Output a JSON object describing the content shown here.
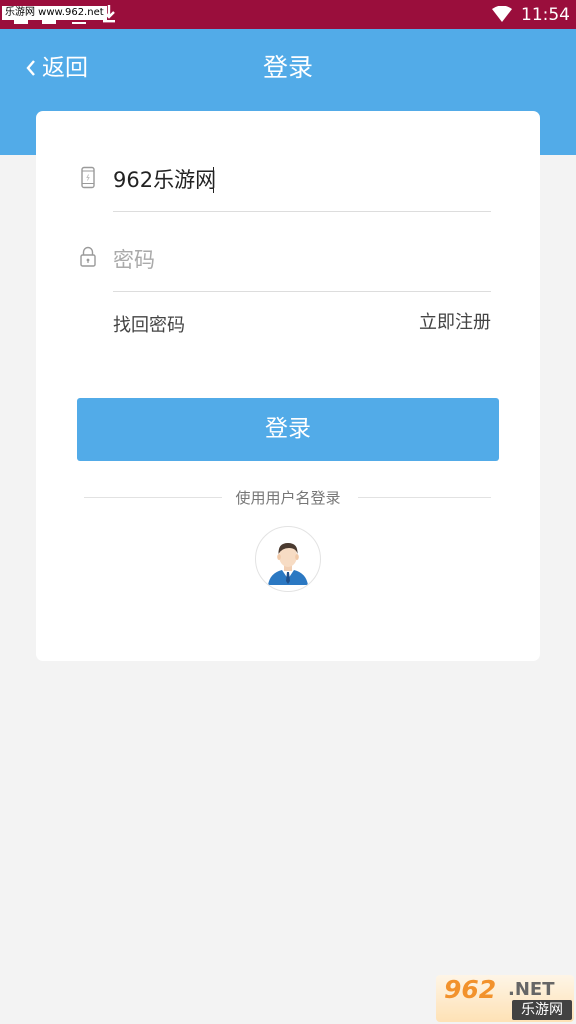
{
  "status_bar": {
    "watermark": "乐游网 www.962.net",
    "time": "11:54",
    "background": "#9a0e3c"
  },
  "header": {
    "back_label": "返回",
    "title": "登录",
    "background": "#52abe8"
  },
  "form": {
    "phone_icon": "mobile-phone-icon",
    "phone_value": "962乐游网",
    "password_icon": "lock-icon",
    "password_placeholder": "密码",
    "forgot_password": "找回密码",
    "register": "立即注册",
    "login_button": "登录"
  },
  "alternate_login": {
    "label": "使用用户名登录",
    "avatar_icon": "user-avatar-icon"
  },
  "brand": {
    "number": "962",
    "suffix": ".NET",
    "name": "乐游网"
  },
  "colors": {
    "accent": "#52abe8",
    "page_background": "#f3f3f3",
    "card_background": "#ffffff"
  }
}
